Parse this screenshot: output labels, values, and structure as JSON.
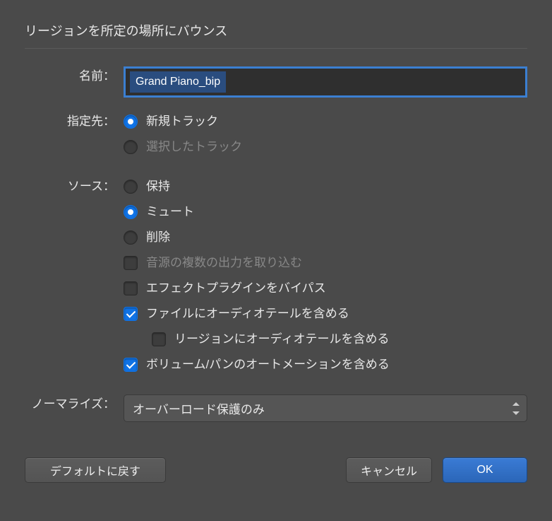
{
  "title": "リージョンを所定の場所にバウンス",
  "name": {
    "label": "名前：",
    "value": "Grand Piano_bip"
  },
  "destination": {
    "label": "指定先：",
    "options": {
      "new_track": {
        "label": "新規トラック",
        "checked": true
      },
      "selected_track": {
        "label": "選択したトラック",
        "checked": false,
        "disabled": true
      }
    }
  },
  "source": {
    "label": "ソース：",
    "options": {
      "keep": {
        "label": "保持",
        "checked": false
      },
      "mute": {
        "label": "ミュート",
        "checked": true
      },
      "delete": {
        "label": "削除",
        "checked": false
      }
    },
    "checkboxes": {
      "include_multi_output": {
        "label": "音源の複数の出力を取り込む",
        "checked": false,
        "disabled": true
      },
      "bypass_fx": {
        "label": "エフェクトプラグインをバイパス",
        "checked": false
      },
      "include_audio_tail_file": {
        "label": "ファイルにオーディオテールを含める",
        "checked": true
      },
      "include_audio_tail_region": {
        "label": "リージョンにオーディオテールを含める",
        "checked": false
      },
      "include_vol_pan_automation": {
        "label": "ボリューム/パンのオートメーションを含める",
        "checked": true
      }
    }
  },
  "normalize": {
    "label": "ノーマライズ：",
    "value": "オーバーロード保護のみ"
  },
  "buttons": {
    "restore_defaults": "デフォルトに戻す",
    "cancel": "キャンセル",
    "ok": "OK"
  }
}
